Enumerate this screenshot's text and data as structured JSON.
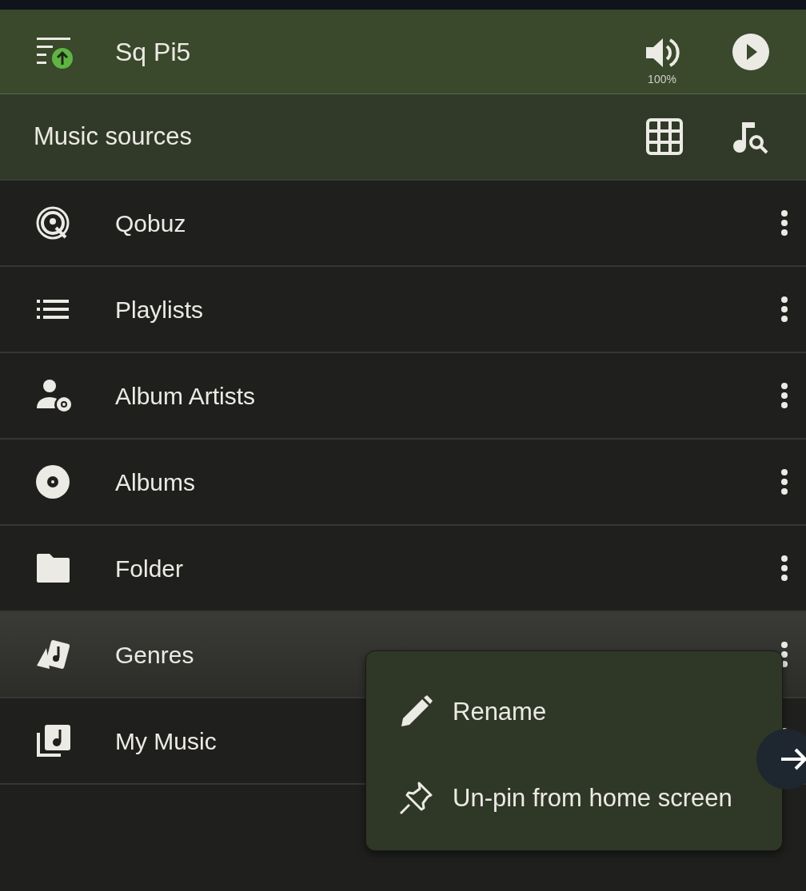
{
  "header": {
    "title": "Sq Pi5",
    "volume": "100%"
  },
  "toolbar": {
    "title": "Music sources"
  },
  "sources": [
    {
      "kind": "qobuz",
      "label": "Qobuz",
      "selected": false
    },
    {
      "kind": "playlists",
      "label": "Playlists",
      "selected": false
    },
    {
      "kind": "artists",
      "label": "Album Artists",
      "selected": false
    },
    {
      "kind": "albums",
      "label": "Albums",
      "selected": false
    },
    {
      "kind": "folder",
      "label": "Folder",
      "selected": false
    },
    {
      "kind": "genres",
      "label": "Genres",
      "selected": true
    },
    {
      "kind": "music",
      "label": "My Music",
      "selected": false
    }
  ],
  "context_menu": {
    "items": [
      {
        "kind": "edit",
        "label": "Rename"
      },
      {
        "kind": "pin",
        "label": "Un-pin from home screen"
      }
    ]
  }
}
